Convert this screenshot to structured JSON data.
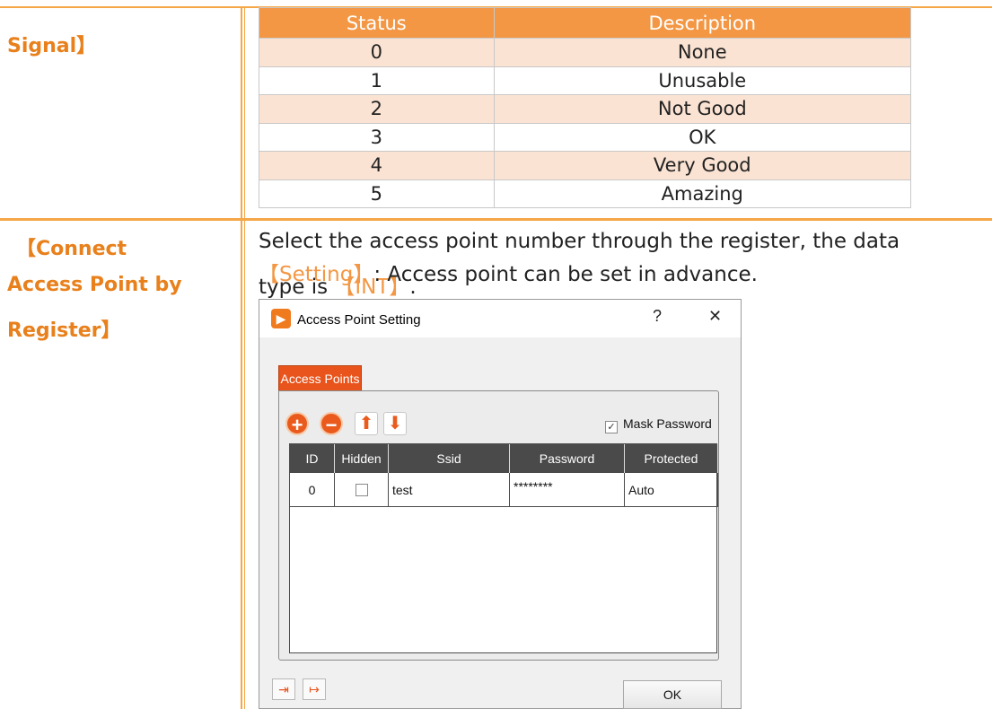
{
  "labels": {
    "signal": "Signal】",
    "connect_line1": "【Connect",
    "connect_line2": "Access Point by",
    "connect_line3": "Register】"
  },
  "status_table": {
    "headers": [
      "Status",
      "Description"
    ],
    "rows": [
      [
        "0",
        "None"
      ],
      [
        "1",
        "Unusable"
      ],
      [
        "2",
        "Not Good"
      ],
      [
        "3",
        "OK"
      ],
      [
        "4",
        "Very Good"
      ],
      [
        "5",
        "Amazing"
      ]
    ]
  },
  "description": {
    "line1": "Select the access point number through the register, the data",
    "line2_prefix": "type is ",
    "line2_type": "【INT】",
    "line2_suffix": ".",
    "setting_label": "【Setting】",
    "setting_text": ": Access point can be set in advance."
  },
  "dialog": {
    "title": "Access Point Setting",
    "help": "?",
    "close": "✕",
    "tab": "Access Points",
    "mask_password": "Mask Password",
    "mask_checked": "✓",
    "columns": [
      "ID",
      "Hidden",
      "Ssid",
      "Password",
      "Protected"
    ],
    "row": {
      "id": "0",
      "ssid": "test",
      "password": "********",
      "protected": "Auto"
    },
    "ok": "OK",
    "icons": [
      "add-icon",
      "remove-icon",
      "move-up-icon",
      "move-down-icon",
      "import-icon",
      "export-icon"
    ]
  },
  "colors": {
    "accent": "#f39744",
    "label": "#e8801c",
    "tab": "#e8541c",
    "row_alt": "#fbe3d3"
  }
}
